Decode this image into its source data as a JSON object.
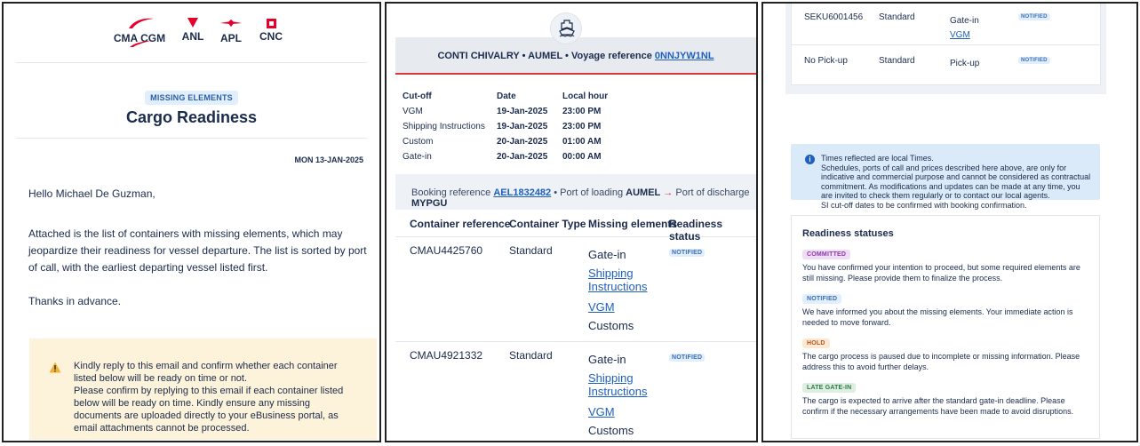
{
  "panel1": {
    "brands": [
      "CMA CGM",
      "ANL",
      "APL",
      "CNC"
    ],
    "badge": "MISSING ELEMENTS",
    "title": "Cargo Readiness",
    "date": "MON 13-JAN-2025",
    "greeting": "Hello Michael De Guzman,",
    "body": "Attached is the list of containers with missing elements, which may jeopardize their readiness for vessel departure. The list is sorted by port of call, with the earliest departing vessel listed first.",
    "thanks": "Thanks in advance.",
    "warning_line1": "Kindly reply to this email and confirm whether each container listed below will be ready on time or not.",
    "warning_line2": "Please confirm by replying to this email if each container listed below will be ready on time. Kindly ensure any missing documents are uploaded directly to your eBusiness portal, as email attachments cannot be processed.",
    "colors": {
      "accent_red": "#e4002b",
      "navy": "#1a2b4c",
      "warning_bg": "#fdf2da"
    }
  },
  "panel2": {
    "voyage_text": "CONTI CHIVALRY • AUMEL • Voyage reference ",
    "voyage_ref": "0NNJYW1NL",
    "cutoff_headers": [
      "Cut-off",
      "Date",
      "Local hour"
    ],
    "cutoff_rows": [
      [
        "VGM",
        "19-Jan-2025",
        "23:00 PM"
      ],
      [
        "Shipping Instructions",
        "19-Jan-2025",
        "23:00 PM"
      ],
      [
        "Custom",
        "20-Jan-2025",
        "01:00 AM"
      ],
      [
        "Gate-in",
        "20-Jan-2025",
        "00:00 AM"
      ]
    ],
    "booking_label": "Booking reference ",
    "booking_ref": "AEL1832482",
    "loading_label": " • Port of loading ",
    "loading_port": "AUMEL",
    "discharge_label": " Port of discharge ",
    "discharge_port": "MYPGU",
    "table_headers": [
      "Container reference",
      "Container Type",
      "Missing elements",
      "Readiness status"
    ],
    "rows": [
      {
        "ref": "CMAU4425760",
        "type": "Standard",
        "missing": [
          "Gate-in",
          "Shipping Instructions",
          "VGM",
          "Customs"
        ],
        "status": "NOTIFIED"
      },
      {
        "ref": "CMAU4921332",
        "type": "Standard",
        "missing": [
          "Gate-in",
          "Shipping Instructions",
          "VGM",
          "Customs"
        ],
        "status": "NOTIFIED"
      }
    ]
  },
  "panel3": {
    "rows": [
      {
        "ref": "SEKU6001456",
        "type": "Standard",
        "missing": [
          "Gate-in",
          "VGM"
        ],
        "status": "NOTIFIED"
      },
      {
        "ref": "No Pick-up",
        "type": "Standard",
        "missing": [
          "Pick-up"
        ],
        "status": "NOTIFIED"
      }
    ],
    "info_lines": [
      "Times reflected are local Times.",
      "Schedules, ports of call and prices described here above, are only for indicative and commercial purpose and cannot be considered as contractual commitment. As modifications and updates can be made at any time, you are invited to check them regularly or to contact our local agents.",
      "SI cut-off dates to be confirmed with booking confirmation."
    ],
    "statuses_title": "Readiness statuses",
    "statuses": [
      {
        "label": "COMMITTED",
        "desc": "You have confirmed your intention to proceed, but some required elements are still missing. Please provide them to finalize the process."
      },
      {
        "label": "NOTIFIED",
        "desc": "We have informed you about the missing elements. Your immediate action is needed to move forward."
      },
      {
        "label": "HOLD",
        "desc": "The cargo process is paused due to incomplete or missing information. Please address this to avoid further delays."
      },
      {
        "label": "LATE GATE-IN",
        "desc": "The cargo is expected to arrive after the standard gate-in deadline. Please confirm if the necessary arrangements have been made to avoid disruptions."
      }
    ]
  }
}
